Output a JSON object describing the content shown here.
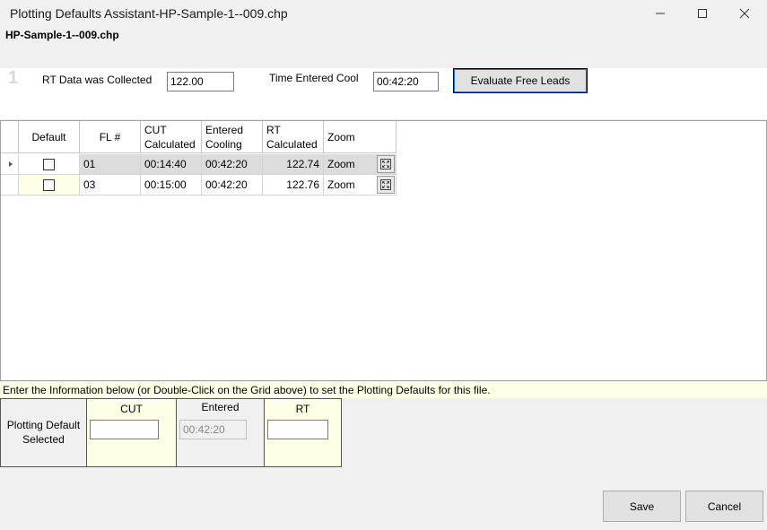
{
  "window": {
    "title": "Plotting Defaults Assistant-HP-Sample-1--009.chp",
    "subtitle": "HP-Sample-1--009.chp"
  },
  "step": {
    "number": "1"
  },
  "form": {
    "rt_label": "RT Data was Collected",
    "rt_value": "122.00",
    "time_label": "Time Entered Cool",
    "time_value": "00:42:20",
    "evaluate_label": "Evaluate Free Leads"
  },
  "grid": {
    "headers": {
      "default": "Default",
      "fl": "FL #",
      "cut_1": "CUT",
      "cut_2": "Calculated",
      "entered_1": "Entered",
      "entered_2": "Cooling",
      "rt_1": "RT",
      "rt_2": "Calculated",
      "zoom": "Zoom"
    },
    "rows": [
      {
        "fl": "01",
        "cut": "00:14:40",
        "entered": "00:42:20",
        "rt": "122.74",
        "zoom": "Zoom"
      },
      {
        "fl": "03",
        "cut": "00:15:00",
        "entered": "00:42:20",
        "rt": "122.76",
        "zoom": "Zoom"
      }
    ]
  },
  "info_text": "Enter the Information below (or Double-Click on the Grid above) to set the Plotting Defaults for this file.",
  "plotting": {
    "selected_label_1": "Plotting Default",
    "selected_label_2": "Selected",
    "cut_header": "CUT",
    "cut_value": "",
    "entered_header": "Entered",
    "entered_value": "00:42:20",
    "rt_header": "RT",
    "rt_value": ""
  },
  "footer": {
    "save_label": "Save",
    "cancel_label": "Cancel"
  },
  "colors": {
    "highlight_yellow": "#ffffe6",
    "row_selected": "#dcdcdc",
    "focus_blue": "#0078d7"
  }
}
